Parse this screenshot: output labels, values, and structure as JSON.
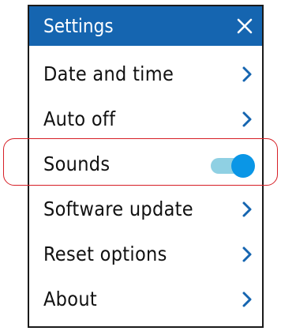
{
  "header": {
    "title": "Settings"
  },
  "menu": {
    "items": [
      {
        "label": "Date and time",
        "control": "chevron"
      },
      {
        "label": "Auto off",
        "control": "chevron"
      },
      {
        "label": "Sounds",
        "control": "toggle",
        "toggle_on": true
      },
      {
        "label": "Software update",
        "control": "chevron"
      },
      {
        "label": "Reset options",
        "control": "chevron"
      },
      {
        "label": "About",
        "control": "chevron"
      }
    ]
  },
  "colors": {
    "header_bg": "#1565b0",
    "accent": "#0a96e6",
    "toggle_track": "#8fd0e3",
    "highlight": "#d61f26"
  },
  "icons": {
    "close": "close-icon",
    "chevron": "chevron-right-icon"
  }
}
